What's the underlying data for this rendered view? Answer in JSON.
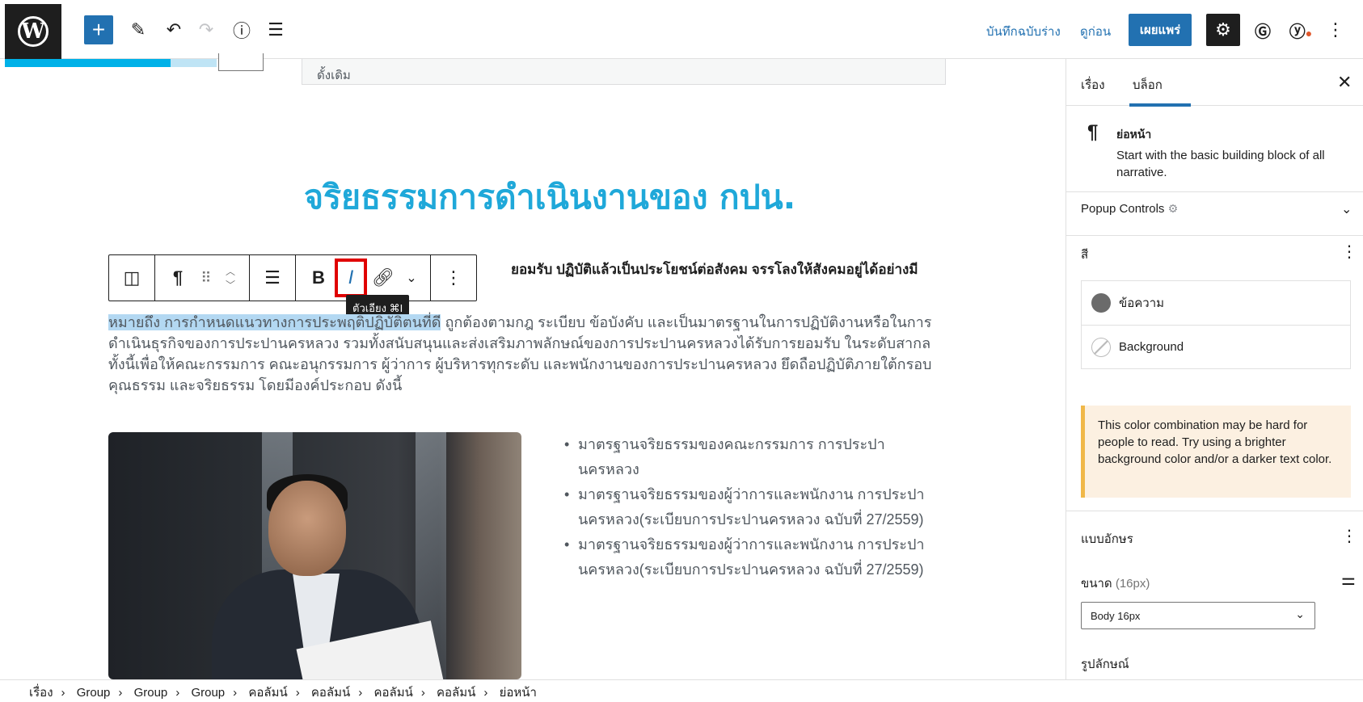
{
  "topbar": {
    "save_draft": "บันทึกฉบับร่าง",
    "preview": "ดูก่อน",
    "publish": "เผยแพร่"
  },
  "canvas": {
    "classic_bar": "ดั้งเดิม",
    "heading": "จริยธรรมการดำเนินงานของ กปน.",
    "bold_line": "ยอมรับ ปฏิบัติแล้วเป็นประโยชน์ต่อสังคม จรรโลงให้สังคมอยู่ได้อย่างมี",
    "para_highlight": "หมายถึง การกำหนดแนวทางการประพฤติปฏิบัติตนที่ดี",
    "para_rest": " ถูกต้องตามกฎ ระเบียบ ข้อบังคับ และเป็นมาตรฐานในการปฏิบัติงานหรือในการดำเนินธุรกิจของการประปานครหลวง รวมทั้งสนับสนุนและส่งเสริมภาพลักษณ์ของการประปานครหลวงได้รับการยอมรับ ในระดับสากล ทั้งนี้เพื่อให้คณะกรรมการ คณะอนุกรรมการ ผู้ว่าการ ผู้บริหารทุกระดับ และพนักงานของการประปานครหลวง ยึดถือปฏิบัติภายใต้กรอบคุณธรรม และจริยธรรม โดยมีองค์ประกอบ ดังนี้",
    "bullets": [
      "มาตรฐานจริยธรรมของคณะกรรมการ การประปานครหลวง",
      "มาตรฐานจริยธรรมของผู้ว่าการและพนักงาน การประปานครหลวง(ระเบียบการประปานครหลวง ฉบับที่ 27/2559)",
      "มาตรฐานจริยธรรมของผู้ว่าการและพนักงาน การประปานครหลวง(ระเบียบการประปานครหลวง ฉบับที่ 27/2559)"
    ]
  },
  "toolbar": {
    "bold": "B",
    "italic": "I",
    "tooltip": "ตัวเอียง ⌘I"
  },
  "sidebar": {
    "tab_post": "เรื่อง",
    "tab_block": "บล็อก",
    "block_title": "ย่อหน้า",
    "block_desc": "Start with the basic building block of all narrative.",
    "popup_controls": "Popup Controls",
    "color_heading": "สี",
    "color_text": "ข้อความ",
    "color_background": "Background",
    "notice": "This color combination may be hard for people to read. Try using a brighter background color and/or a darker text color.",
    "typography": "แบบอักษร",
    "size_label": "ขนาด",
    "size_value": "(16px)",
    "size_select": "Body 16px",
    "appearance": "รูปลักษณ์"
  },
  "breadcrumb": [
    "เรื่อง",
    "Group",
    "Group",
    "Group",
    "คอลัมน์",
    "คอลัมน์",
    "คอลัมน์",
    "คอลัมน์",
    "ย่อหน้า"
  ],
  "colors": {
    "accent": "#2271b1",
    "heading": "#1fa8d9",
    "warning_border": "#f0b849"
  }
}
